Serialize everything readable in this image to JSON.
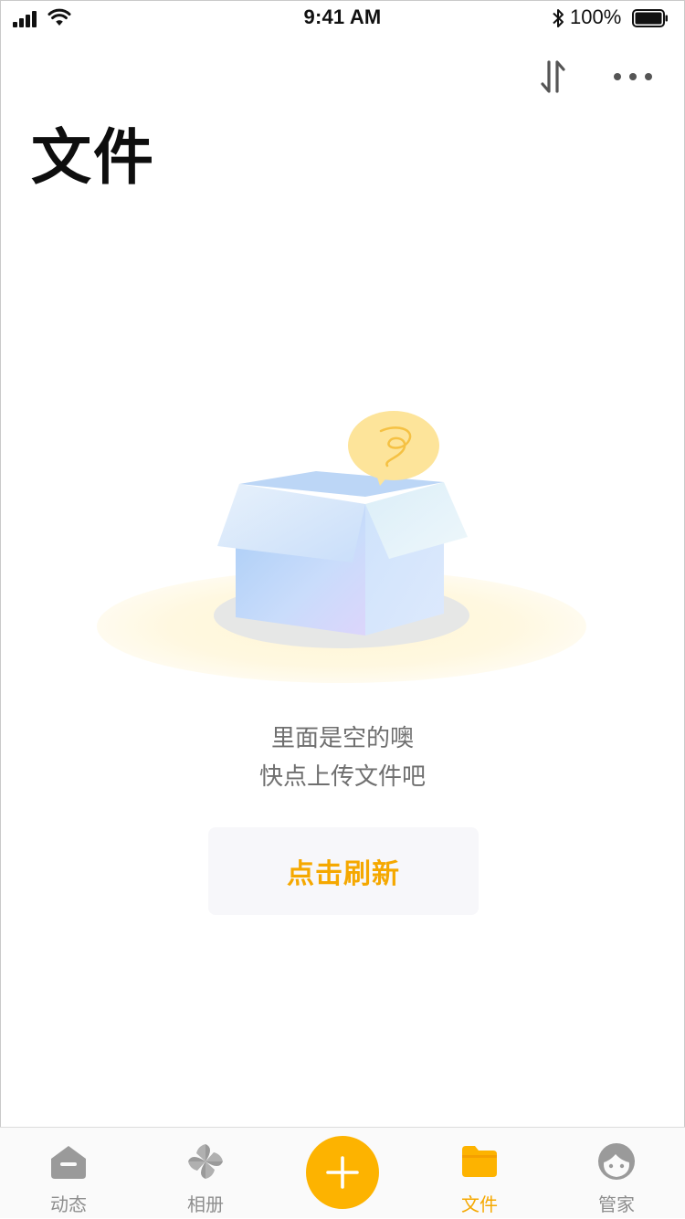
{
  "status_bar": {
    "time": "9:41 AM",
    "battery_percent": "100%",
    "battery_level": 1.0
  },
  "header": {
    "title": "文件",
    "transfer_icon": "transfer-icon",
    "more_icon": "more-icon"
  },
  "empty_state": {
    "line1": "里面是空的噢",
    "line2": "快点上传文件吧",
    "illustration": "empty-box-illustration"
  },
  "refresh_button": {
    "label": "点击刷新"
  },
  "tab_bar": {
    "tabs": [
      {
        "label": "动态",
        "icon": "home-icon"
      },
      {
        "label": "相册",
        "icon": "pinwheel-icon"
      },
      {
        "label": "",
        "icon": "plus-icon"
      },
      {
        "label": "文件",
        "icon": "folder-icon",
        "active": true
      },
      {
        "label": "管家",
        "icon": "face-icon"
      }
    ]
  },
  "colors": {
    "accent": "#F5A800",
    "add_button": "#FDB300",
    "inactive_tab": "#8E8E8E",
    "empty_text": "#6F6F6F"
  }
}
